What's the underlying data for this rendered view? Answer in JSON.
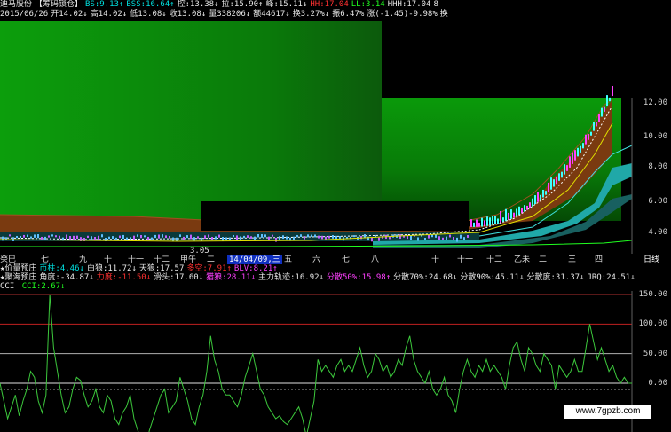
{
  "header": {
    "title_items": [
      {
        "text": "迪马股份",
        "cls": "c-white"
      },
      {
        "text": "【筹码锁仓】",
        "cls": "c-white"
      },
      {
        "text": "BS:9.13↑",
        "cls": "c-cyan"
      },
      {
        "text": "BSS:16.64↑",
        "cls": "c-cyan"
      },
      {
        "text": "控:13.38↓",
        "cls": "c-white"
      },
      {
        "text": "拉:15.90↑",
        "cls": "c-white"
      },
      {
        "text": "峰:15.11↓",
        "cls": "c-white"
      },
      {
        "text": "HH:17.04",
        "cls": "c-red"
      },
      {
        "text": "LL:3.14",
        "cls": "c-green"
      },
      {
        "text": "HHH:17.04",
        "cls": "c-white"
      },
      {
        "text": "8",
        "cls": "c-white"
      }
    ],
    "ohlc_items": [
      {
        "text": "2015/06/26",
        "cls": "c-white"
      },
      {
        "text": "开14.02↓",
        "cls": "c-white"
      },
      {
        "text": "高14.02↓",
        "cls": "c-white"
      },
      {
        "text": "低13.08↓",
        "cls": "c-white"
      },
      {
        "text": "收13.08↓",
        "cls": "c-white"
      },
      {
        "text": "量338206↓",
        "cls": "c-white"
      },
      {
        "text": "额44617↓",
        "cls": "c-white"
      },
      {
        "text": "换3.27%↓",
        "cls": "c-white"
      },
      {
        "text": "振6.47%",
        "cls": "c-white"
      },
      {
        "text": "涨(-1.45)-9.98%",
        "cls": "c-white"
      },
      {
        "text": "换",
        "cls": "c-white"
      }
    ]
  },
  "price_axis": [
    "12.00",
    "10.00",
    "8.00",
    "6.00",
    "4.00"
  ],
  "low_label": "3.05",
  "x_axis": {
    "date_labels": [
      {
        "text": "癸巳",
        "x": 0
      },
      {
        "text": "七",
        "x": 46
      },
      {
        "text": "九",
        "x": 89
      },
      {
        "text": "十",
        "x": 117
      },
      {
        "text": "十一",
        "x": 144
      },
      {
        "text": "十二",
        "x": 173
      },
      {
        "text": "甲午",
        "x": 203
      },
      {
        "text": "二",
        "x": 233
      },
      {
        "text": "三",
        "x": 256
      },
      {
        "text": "五",
        "x": 320
      },
      {
        "text": "六",
        "x": 352
      },
      {
        "text": "七",
        "x": 385
      },
      {
        "text": "八",
        "x": 418
      },
      {
        "text": "十",
        "x": 486
      },
      {
        "text": "十一",
        "x": 515
      },
      {
        "text": "十二",
        "x": 548
      },
      {
        "text": "乙未",
        "x": 579
      },
      {
        "text": "二",
        "x": 607
      },
      {
        "text": "三",
        "x": 640
      },
      {
        "text": "四",
        "x": 670
      }
    ],
    "highlight_date": "14/04/09,三",
    "period_button": "日线"
  },
  "indicator_rows": [
    [
      {
        "text": "★价量预庄",
        "cls": "c-white"
      },
      {
        "text": "币柱:4.46↓",
        "cls": "c-cyan"
      },
      {
        "text": "白狼:11.72↓",
        "cls": "c-white"
      },
      {
        "text": "天狼:17.57",
        "cls": "c-white"
      },
      {
        "text": "多空:7.91↑",
        "cls": "c-red"
      },
      {
        "text": "BLV:8.21↑",
        "cls": "c-magenta"
      }
    ],
    [
      {
        "text": "★聚海预庄",
        "cls": "c-white"
      },
      {
        "text": "角度:-34.87↓",
        "cls": "c-white"
      },
      {
        "text": "力度:-11.50↓",
        "cls": "c-red"
      },
      {
        "text": "滑头:17.60↓",
        "cls": "c-white"
      },
      {
        "text": "猎狼:28.11↓",
        "cls": "c-magenta"
      },
      {
        "text": "主力轨迹:16.92↓",
        "cls": "c-white"
      },
      {
        "text": "分散50%:15.98↑",
        "cls": "c-magenta"
      },
      {
        "text": "分散70%:24.68↓",
        "cls": "c-white"
      },
      {
        "text": "分散90%:45.11↓",
        "cls": "c-white"
      },
      {
        "text": "分散度:31.37↓",
        "cls": "c-white"
      },
      {
        "text": "JRQ:24.51↓",
        "cls": "c-white"
      }
    ]
  ],
  "cci": {
    "label": "CCI",
    "value_text": "CCI:2.67↓",
    "axis": [
      "150.00",
      "100.00",
      "50.00",
      "0.00"
    ],
    "series": [
      0,
      -30,
      -60,
      -40,
      -20,
      -55,
      -30,
      -10,
      20,
      10,
      -30,
      -50,
      -20,
      150,
      60,
      20,
      -20,
      -50,
      -40,
      -10,
      10,
      5,
      -20,
      -40,
      -30,
      -10,
      -40,
      -50,
      -20,
      -30,
      -60,
      -70,
      -50,
      -40,
      -20,
      -60,
      -80,
      -100,
      -110,
      -80,
      -60,
      -40,
      -20,
      -10,
      -50,
      -40,
      -30,
      10,
      -10,
      -30,
      -60,
      -70,
      -40,
      -20,
      20,
      80,
      40,
      20,
      -10,
      -20,
      -20,
      -30,
      -40,
      -20,
      10,
      30,
      50,
      20,
      -10,
      -20,
      -40,
      -50,
      -60,
      -55,
      -65,
      -70,
      -60,
      -50,
      -40,
      -60,
      -90,
      -60,
      -30,
      40,
      20,
      30,
      20,
      10,
      30,
      40,
      20,
      30,
      20,
      40,
      60,
      30,
      10,
      20,
      50,
      40,
      20,
      30,
      10,
      20,
      40,
      30,
      60,
      80,
      40,
      20,
      10,
      0,
      20,
      -10,
      -20,
      -10,
      10,
      -20,
      -30,
      -50,
      -10,
      20,
      40,
      20,
      10,
      30,
      20,
      40,
      20,
      30,
      20,
      10,
      -10,
      30,
      60,
      70,
      40,
      20,
      60,
      50,
      30,
      20,
      50,
      40,
      30,
      -10,
      30,
      20,
      10,
      20,
      40,
      20,
      20,
      60,
      100,
      70,
      40,
      60,
      40,
      20,
      30,
      10,
      0,
      10,
      0,
      0
    ]
  },
  "colors": {
    "green_bg": "#0a8a0a",
    "brown_band": "#7a3a10",
    "cyan_band": "#20a8a8",
    "cci_line": "#3cc83c"
  },
  "watermark": "www.7gpzb.com"
}
